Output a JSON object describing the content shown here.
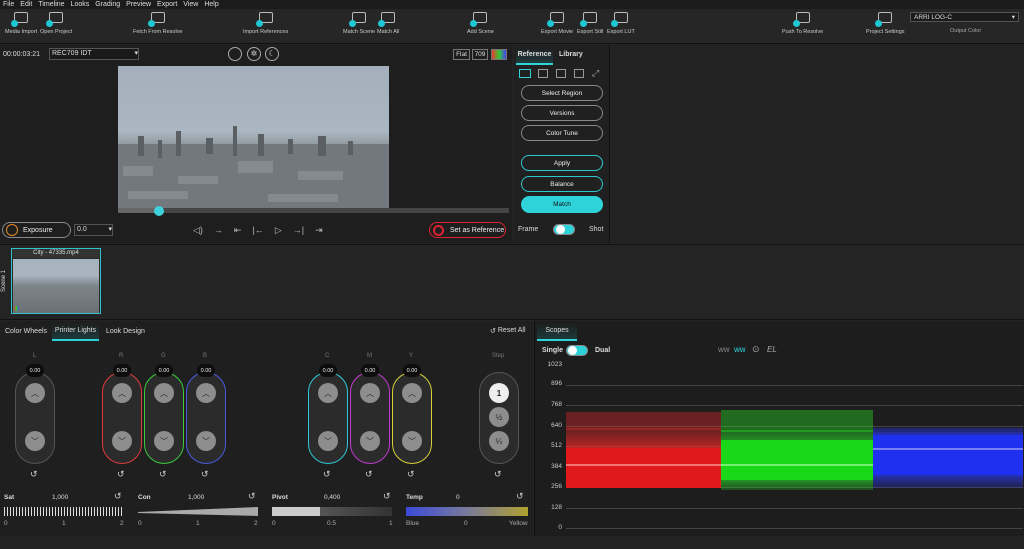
{
  "menu": [
    "File",
    "Edit",
    "Timeline",
    "Looks",
    "Grading",
    "Preview",
    "Export",
    "View",
    "Help"
  ],
  "toolbar": [
    {
      "label": "Media Import",
      "icon": "media-import-icon"
    },
    {
      "label": "Open Project",
      "icon": "folder-icon"
    },
    {
      "label": "Fetch From Resolve",
      "icon": "fetch-icon"
    },
    {
      "label": "Import References",
      "icon": "import-references-icon"
    },
    {
      "label": "Match Scene",
      "icon": "match-scene-icon"
    },
    {
      "label": "Match All",
      "icon": "match-all-icon"
    },
    {
      "label": "Add Scene",
      "icon": "add-scene-icon"
    },
    {
      "label": "Export Movie",
      "icon": "export-movie-icon"
    },
    {
      "label": "Export Still",
      "icon": "export-still-icon"
    },
    {
      "label": "Export LUT",
      "icon": "export-lut-icon"
    },
    {
      "label": "Push To Resolve",
      "icon": "push-icon"
    },
    {
      "label": "Project Settings",
      "icon": "gear-icon"
    }
  ],
  "output_color": {
    "value": "ARRI LOG-C",
    "label": "Output Color"
  },
  "viewer": {
    "timecode": "00:00:03:21",
    "idt": "REC709 IDT",
    "flat": "Flat",
    "rec": "709",
    "exposure": "Exposure",
    "exposure_value": "0.0",
    "set_reference": "Set as Reference",
    "progress": 0.1
  },
  "ref_panel": {
    "tab_reference": "Reference",
    "tab_library": "Library",
    "select_region": "Select Region",
    "versions": "Versions",
    "color_tune": "Color Tune",
    "apply": "Apply",
    "balance": "Balance",
    "match": "Match",
    "frame": "Frame",
    "shot": "Shot"
  },
  "scene": {
    "label": "Scene 1",
    "clip": "City - 47335.mp4"
  },
  "grading": {
    "tabs": [
      "Color Wheels",
      "Printer Lights",
      "Look Design"
    ],
    "active_tab": "Printer Lights",
    "reset_all": "Reset All",
    "channels": [
      {
        "name": "L",
        "value": "0.00",
        "color": "#6a6a6a"
      },
      {
        "name": "R",
        "value": "0.00",
        "color": "#e03a3a"
      },
      {
        "name": "G",
        "value": "0.00",
        "color": "#3ccb3c"
      },
      {
        "name": "B",
        "value": "0.00",
        "color": "#4a5ae0"
      },
      {
        "name": "C",
        "value": "0.00",
        "color": "#2ec8d6"
      },
      {
        "name": "M",
        "value": "0.00",
        "color": "#c03cd0"
      },
      {
        "name": "Y",
        "value": "0.00",
        "color": "#d6d03a"
      }
    ],
    "step": {
      "label": "Step",
      "values": [
        "1",
        "½",
        "¼"
      ]
    },
    "sliders": [
      {
        "name": "Sat",
        "value": "1,000",
        "ticks": [
          "0",
          "1",
          "2"
        ]
      },
      {
        "name": "Con",
        "value": "1,000",
        "ticks": [
          "0",
          "1",
          "2"
        ]
      },
      {
        "name": "Pivot",
        "value": "0,400",
        "ticks": [
          "0",
          "0.5",
          "1"
        ]
      },
      {
        "name": "Temp",
        "value": "0",
        "ticks": [
          "Blue",
          "0",
          "Yellow"
        ]
      }
    ]
  },
  "scopes": {
    "tab": "Scopes",
    "single": "Single",
    "dual": "Dual",
    "el": "EL",
    "y_ticks": [
      "1023",
      "896",
      "768",
      "640",
      "512",
      "384",
      "256",
      "128",
      "0"
    ]
  },
  "colors": {
    "accent": "#2ed3da"
  }
}
